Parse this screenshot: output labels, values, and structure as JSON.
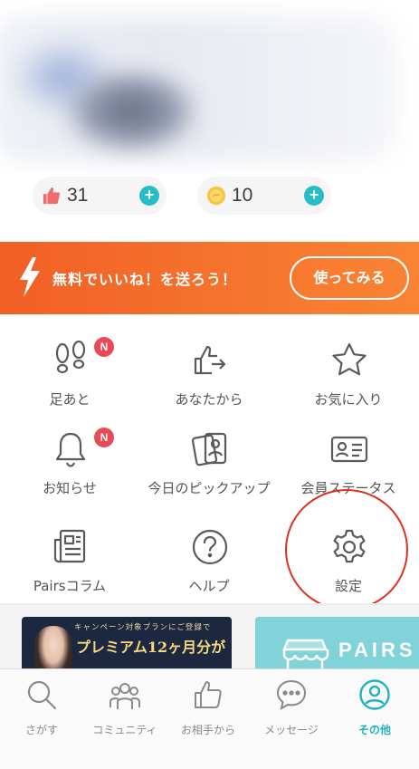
{
  "points": {
    "likes_value": "31",
    "coins_value": "10",
    "plus_symbol": "+"
  },
  "promo": {
    "text": "無料でいいね！を送ろう！",
    "button_label": "使ってみる"
  },
  "menu": {
    "items": [
      {
        "label": "足あと",
        "icon": "footprints-icon",
        "badge": "N"
      },
      {
        "label": "あなたから",
        "icon": "thumbs-up-arrow-icon"
      },
      {
        "label": "お気に入り",
        "icon": "star-icon"
      },
      {
        "label": "お知らせ",
        "icon": "bell-icon",
        "badge": "N"
      },
      {
        "label": "今日のピックアップ",
        "icon": "pickup-cards-icon"
      },
      {
        "label": "会員ステータス",
        "icon": "id-card-icon"
      },
      {
        "label": "Pairsコラム",
        "icon": "newspaper-icon"
      },
      {
        "label": "ヘルプ",
        "icon": "question-icon"
      },
      {
        "label": "設定",
        "icon": "gear-icon"
      }
    ]
  },
  "ads": {
    "premium_top": "キャンペーン対象プランにご登録で",
    "premium_main": "プレミアム12ヶ月分が",
    "store_word": "PAIRS"
  },
  "tabbar": {
    "tabs": [
      {
        "label": "さがす",
        "icon": "search-icon"
      },
      {
        "label": "コミュニティ",
        "icon": "community-icon"
      },
      {
        "label": "お相手から",
        "icon": "thumbs-up-icon"
      },
      {
        "label": "メッセージ",
        "icon": "message-icon"
      },
      {
        "label": "その他",
        "icon": "profile-icon",
        "active": true
      }
    ]
  },
  "colors": {
    "accent_teal": "#1fb3be",
    "promo_orange": "#f15f25",
    "badge_red": "#e94a55",
    "highlight_circle": "#e0311f"
  }
}
